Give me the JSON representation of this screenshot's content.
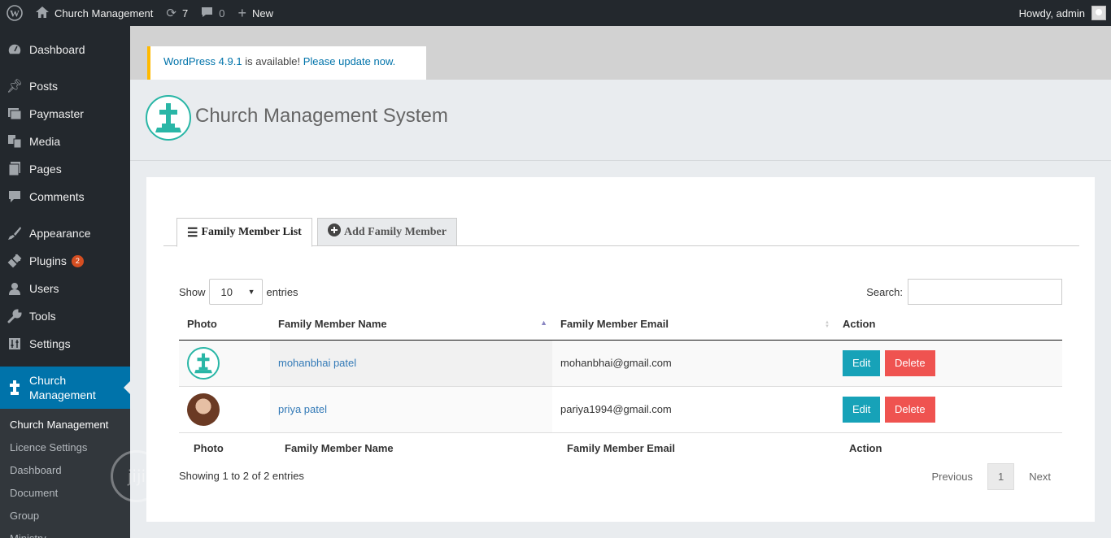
{
  "adminbar": {
    "site_name": "Church Management",
    "updates_count": "7",
    "comments_count": "0",
    "new_label": "New",
    "howdy": "Howdy, admin"
  },
  "sidebar": {
    "items": [
      {
        "label": "Dashboard",
        "icon": "dashboard-icon"
      },
      {
        "label": "Posts",
        "icon": "pin-icon"
      },
      {
        "label": "Paymaster",
        "icon": "images-icon"
      },
      {
        "label": "Media",
        "icon": "media-icon"
      },
      {
        "label": "Pages",
        "icon": "pages-icon"
      },
      {
        "label": "Comments",
        "icon": "comment-icon"
      },
      {
        "label": "Appearance",
        "icon": "brush-icon"
      },
      {
        "label": "Plugins",
        "icon": "plugin-icon",
        "badge": "2"
      },
      {
        "label": "Users",
        "icon": "user-icon"
      },
      {
        "label": "Tools",
        "icon": "wrench-icon"
      },
      {
        "label": "Settings",
        "icon": "settings-icon"
      },
      {
        "label": "Church Management",
        "icon": "cross-icon"
      }
    ],
    "submenu": [
      "Church Management",
      "Licence Settings",
      "Dashboard",
      "Document",
      "Group",
      "Ministry"
    ]
  },
  "notice": {
    "link1": "WordPress 4.9.1",
    "text": " is available! ",
    "link2": "Please update now."
  },
  "header": {
    "title": "Church Management System"
  },
  "tabs": {
    "list": "Family Member List",
    "add": "Add Family Member"
  },
  "table_controls": {
    "show": "Show",
    "entries_value": "10",
    "entries": "entries",
    "search": "Search:"
  },
  "table": {
    "columns": [
      "Photo",
      "Family Member Name",
      "Family Member Email",
      "Action"
    ],
    "rows": [
      {
        "name": "mohanbhai patel",
        "email": "mohanbhai@gmail.com",
        "photo": "logo"
      },
      {
        "name": "priya patel",
        "email": "pariya1994@gmail.com",
        "photo": "woman"
      }
    ],
    "edit_label": "Edit",
    "delete_label": "Delete"
  },
  "footer": {
    "info": "Showing 1 to 2 of 2 entries",
    "previous": "Previous",
    "page": "1",
    "next": "Next"
  },
  "colors": {
    "accent": "#0073aa",
    "edit": "#17a2b8",
    "delete": "#ef5350",
    "logo": "#29b6a6"
  }
}
